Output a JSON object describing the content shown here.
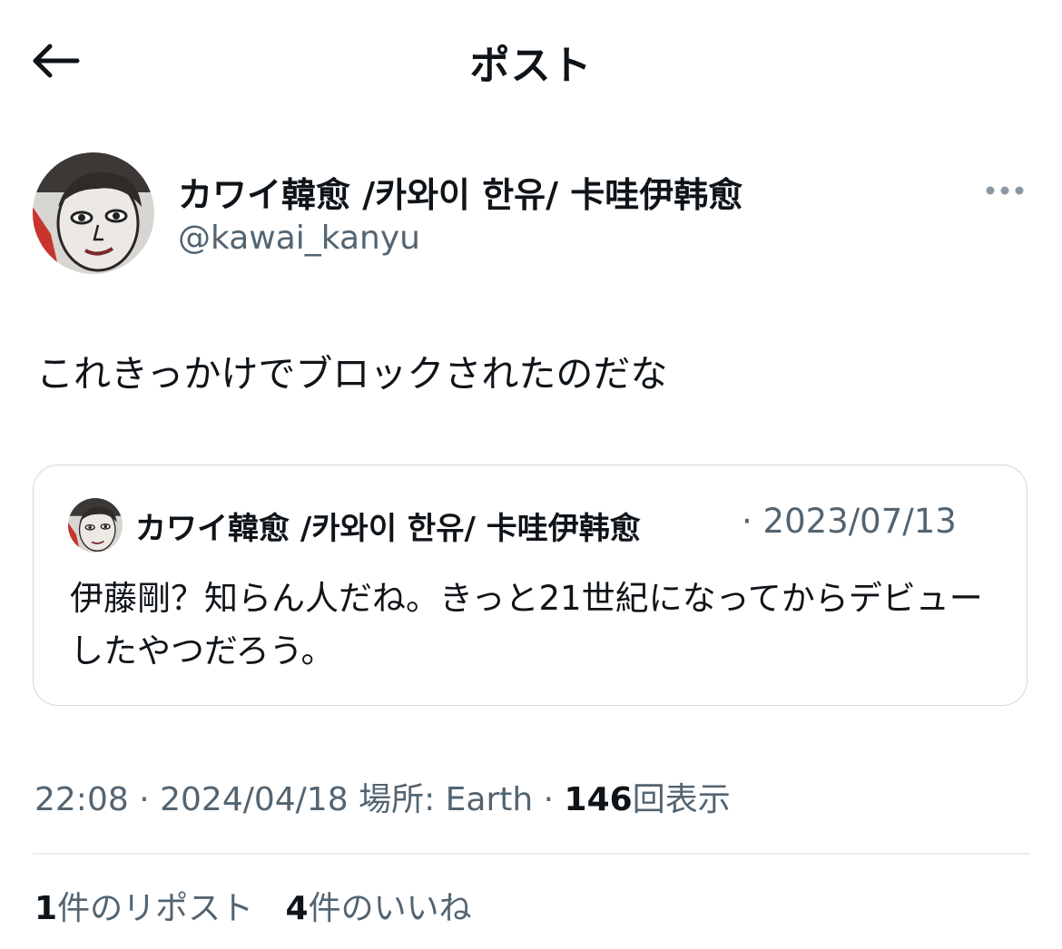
{
  "header": {
    "title": "ポスト",
    "back_icon": "arrow-left-icon"
  },
  "author": {
    "name": "カワイ韓愈 /카와이 한유/ 卡哇伊韩愈",
    "handle": "@kawai_kanyu",
    "more_icon": "more-horizontal-icon"
  },
  "post": {
    "text": "これきっかけでブロックされたのだな"
  },
  "quote": {
    "name": "カワイ韓愈 /카와이 한유/ 卡哇伊韩愈",
    "date": "2023/07/13",
    "separator": "·",
    "text": "伊藤剛？知らん人だね。きっと21世紀になってからデビューしたやつだろう。"
  },
  "meta": {
    "time": "22:08",
    "date": "2024/04/18",
    "location": "場所: Earth",
    "views_count": "146",
    "views_label": "回表示",
    "separator": "·"
  },
  "stats": {
    "reposts_count": "1",
    "reposts_label": "件のリポスト",
    "likes_count": "4",
    "likes_label": "件のいいね"
  },
  "colors": {
    "text": "#0f1419",
    "secondary": "#536471",
    "border": "#cfd9de"
  }
}
